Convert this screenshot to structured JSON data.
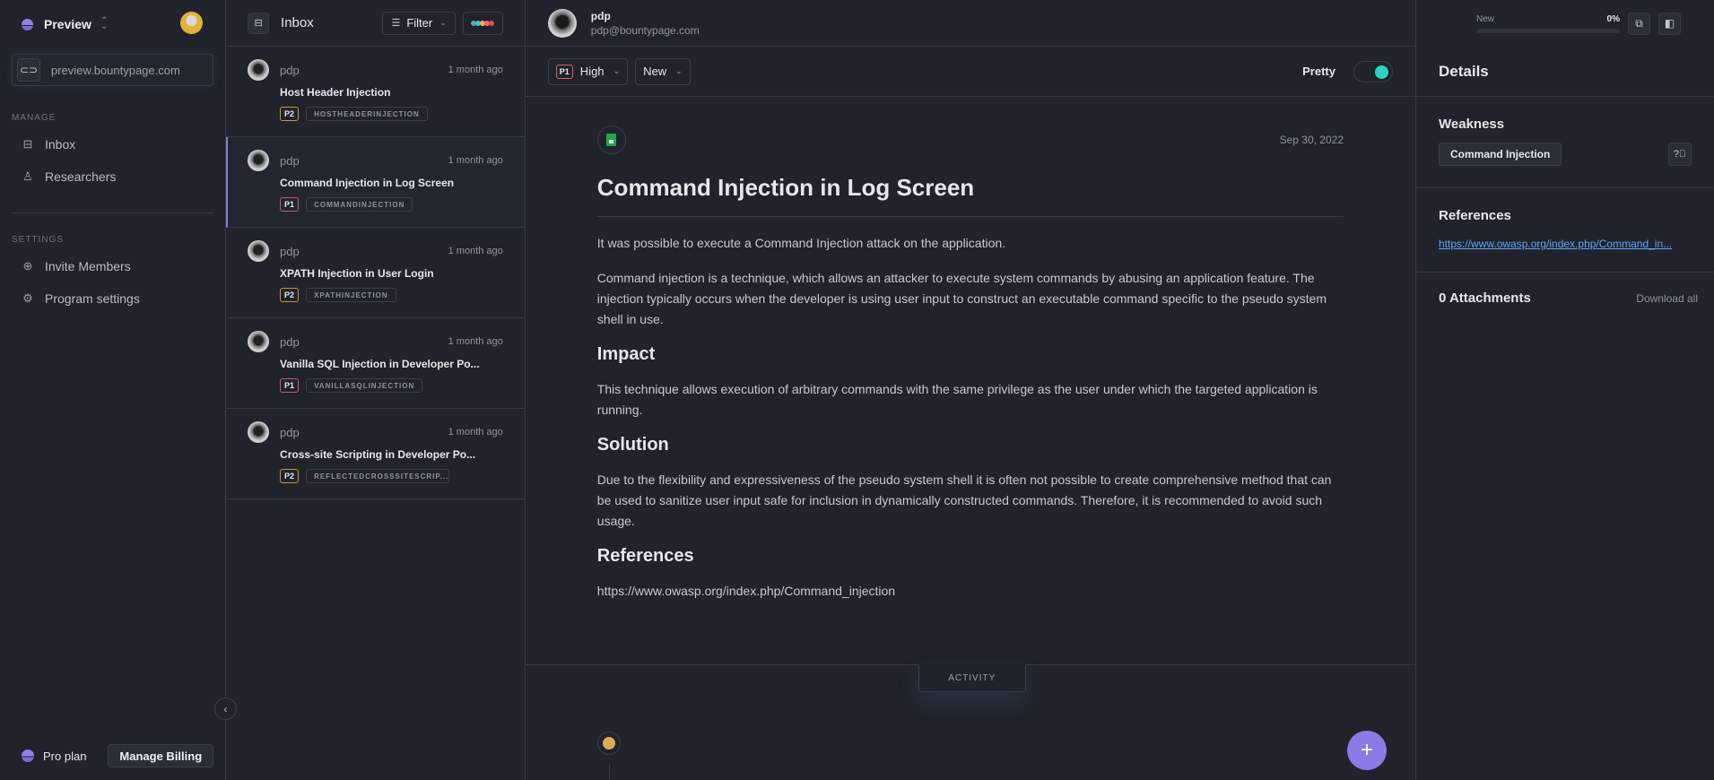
{
  "sidebar": {
    "workspace_name": "Preview",
    "url": "preview.bountypage.com",
    "manage_label": "MANAGE",
    "manage_items": [
      {
        "label": "Inbox",
        "icon": "inbox-icon"
      },
      {
        "label": "Researchers",
        "icon": "user-icon"
      }
    ],
    "settings_label": "SETTINGS",
    "settings_items": [
      {
        "label": "Invite Members",
        "icon": "plus-circle-icon"
      },
      {
        "label": "Program settings",
        "icon": "gear-icon"
      }
    ],
    "plan_label": "Pro plan",
    "billing_button": "Manage Billing"
  },
  "inbox": {
    "title": "Inbox",
    "filter_label": "Filter",
    "status_dot_colors": [
      "#8a93a3",
      "#2dd4bf",
      "#f6ad55",
      "#f0667d",
      "#ef4444"
    ],
    "reports": [
      {
        "user": "pdp",
        "time": "1 month ago",
        "title": "Host Header Injection",
        "priority": "P2",
        "tag": "HOSTHEADERINJECTION",
        "active": false
      },
      {
        "user": "pdp",
        "time": "1 month ago",
        "title": "Command Injection in Log Screen",
        "priority": "P1",
        "tag": "COMMANDINJECTION",
        "active": true
      },
      {
        "user": "pdp",
        "time": "1 month ago",
        "title": "XPATH Injection in User Login",
        "priority": "P2",
        "tag": "XPATHINJECTION",
        "active": false
      },
      {
        "user": "pdp",
        "time": "1 month ago",
        "title": "Vanilla SQL Injection in Developer Po...",
        "priority": "P1",
        "tag": "VANILLASQLINJECTION",
        "active": false
      },
      {
        "user": "pdp",
        "time": "1 month ago",
        "title": "Cross-site Scripting in Developer Po...",
        "priority": "P2",
        "tag": "REFLECTEDCROSSSITESCRIP...",
        "active": false
      }
    ]
  },
  "report": {
    "reporter_name": "pdp",
    "reporter_email": "pdp@bountypage.com",
    "severity_badge": "P1",
    "severity_label": "High",
    "status_label": "New",
    "pretty_label": "Pretty",
    "pretty_enabled": true,
    "date": "Sep 30, 2022",
    "title": "Command Injection in Log Screen",
    "intro": "It was possible to execute a Command Injection attack on the application.",
    "description": "Command injection is a technique, which allows an attacker to execute system commands by abusing an application feature. The injection typically occurs when the developer is using user input to construct an executable command specific to the pseudo system shell in use.",
    "impact_heading": "Impact",
    "impact": "This technique allows execution of arbitrary commands with the same privilege as the user under which the targeted application is running.",
    "solution_heading": "Solution",
    "solution": "Due to the flexibility and expressiveness of the pseudo system shell it is often not possible to create comprehensive method that can be used to sanitize user input safe for inclusion in dynamically constructed commands. Therefore, it is recommended to avoid such usage.",
    "references_heading": "References",
    "reference_url": "https://www.owasp.org/index.php/Command_injection",
    "activity_tab": "ACTIVITY"
  },
  "progress": {
    "label": "New",
    "value_text": "0%",
    "percent": 0
  },
  "details": {
    "title": "Details",
    "weakness_label": "Weakness",
    "weakness_value": "Command Injection",
    "references_label": "References",
    "reference_link": "https://www.owasp.org/index.php/Command_in...",
    "attachments_label": "0 Attachments",
    "download_all": "Download all"
  }
}
